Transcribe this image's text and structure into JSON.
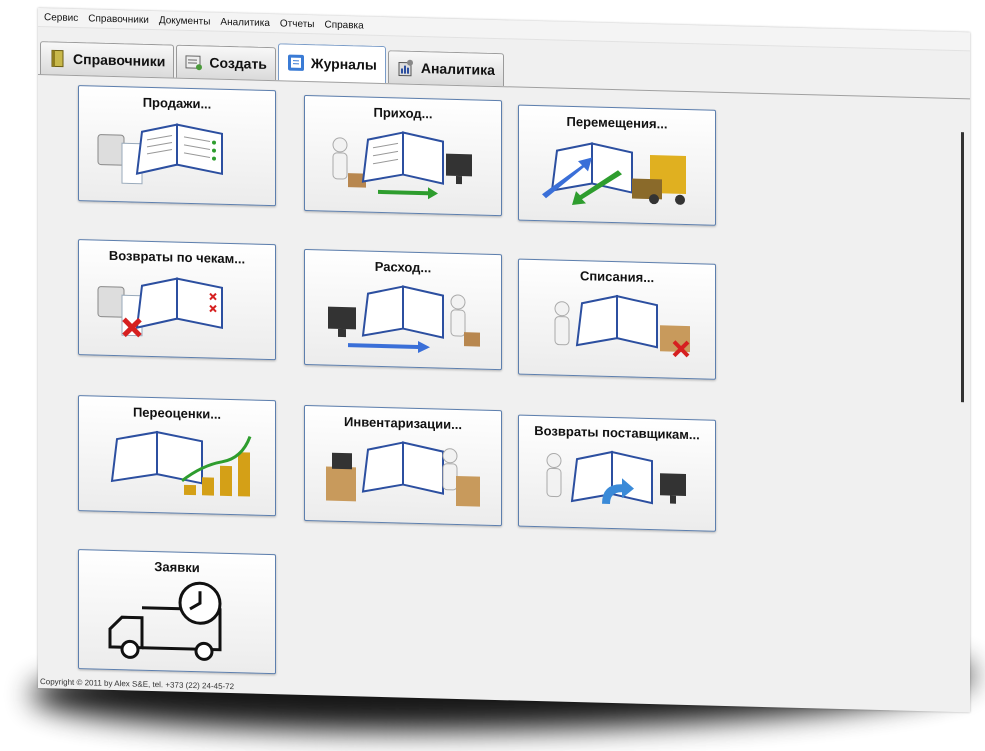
{
  "menu": [
    "Сервис",
    "Справочники",
    "Документы",
    "Аналитика",
    "Отчеты",
    "Справка"
  ],
  "tabs": [
    {
      "label": "Справочники",
      "icon": "book-icon"
    },
    {
      "label": "Создать",
      "icon": "create-document-icon"
    },
    {
      "label": "Журналы",
      "icon": "journal-icon",
      "active": true
    },
    {
      "label": "Аналитика",
      "icon": "analytics-icon"
    }
  ],
  "cards": {
    "sales": "Продажи...",
    "income": "Приход...",
    "transfers": "Перемещения...",
    "check_returns": "Возвраты по чекам...",
    "expense": "Расход...",
    "writeoffs": "Списания...",
    "revaluations": "Переоценки...",
    "inventory": "Инвентаризации...",
    "supplier_returns": "Возвраты поставщикам...",
    "requests": "Заявки"
  },
  "status": "Copyright © 2011 by Alex S&E, tel. +373 (22) 24-45-72",
  "colors": {
    "accent": "#5d7fae",
    "check": "#2e9d2e",
    "cross": "#d62020",
    "book": "#2c4fa0"
  }
}
